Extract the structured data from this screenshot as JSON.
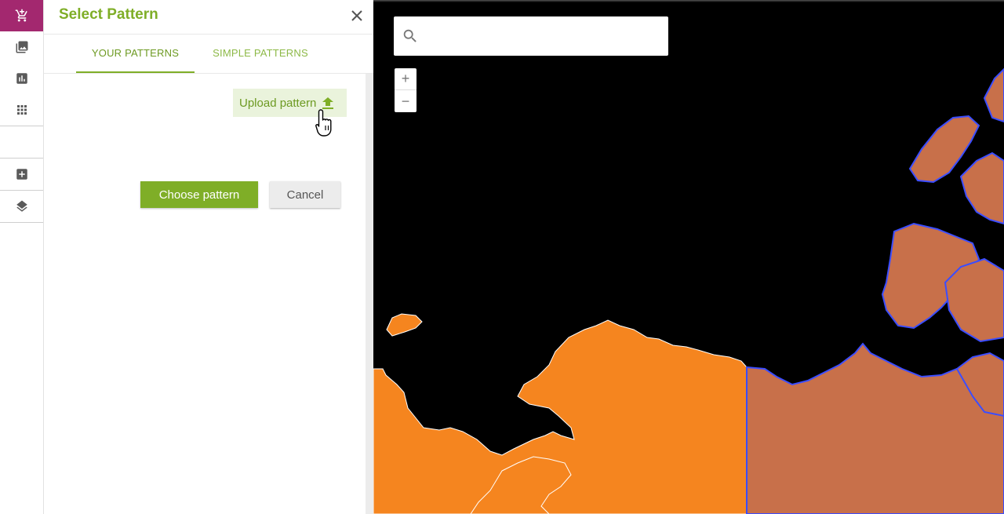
{
  "toolbar": {
    "items": [
      {
        "name": "cart-add",
        "active": true
      },
      {
        "name": "image"
      },
      {
        "name": "chart"
      },
      {
        "name": "grid"
      },
      {
        "name": "add-box"
      },
      {
        "name": "layers"
      }
    ],
    "active_color": "#a3286f"
  },
  "panel": {
    "title": "Select Pattern",
    "tabs": [
      {
        "label": "YOUR PATTERNS",
        "active": true
      },
      {
        "label": "SIMPLE PATTERNS",
        "active": false
      }
    ],
    "upload_label": "Upload pattern",
    "choose_label": "Choose pattern",
    "cancel_label": "Cancel",
    "accent_color": "#7fae27"
  },
  "map": {
    "search_placeholder": "",
    "zoom_in": "+",
    "zoom_out": "−",
    "fill_selected": "#c8704a",
    "fill_other": "#f5851f",
    "outline_selected": "#3b4dff"
  }
}
